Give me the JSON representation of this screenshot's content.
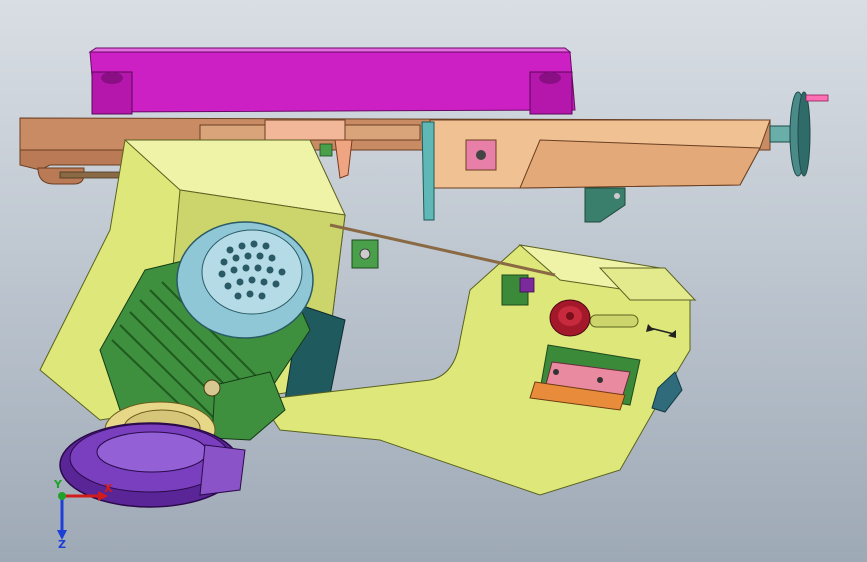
{
  "viewport": {
    "background_top": "#d9dee4",
    "background_bottom": "#9ea9b6"
  },
  "triad": {
    "x_label": "X",
    "y_label": "Y",
    "z_label": "Z",
    "x_color": "#d21c1c",
    "y_color": "#1fa12a",
    "z_color": "#1e3fd6"
  },
  "parts": {
    "top_plate_color": "#cc1fc4",
    "rail_color": "#d9a47a",
    "arm_color": "#dde77a",
    "motor_color": "#3e8f3e",
    "motor_cap_color": "#8fc7d6",
    "pulley_color": "#5a2596",
    "knob_color": "#a3182a",
    "handwheel_color": "#4a8a88"
  }
}
